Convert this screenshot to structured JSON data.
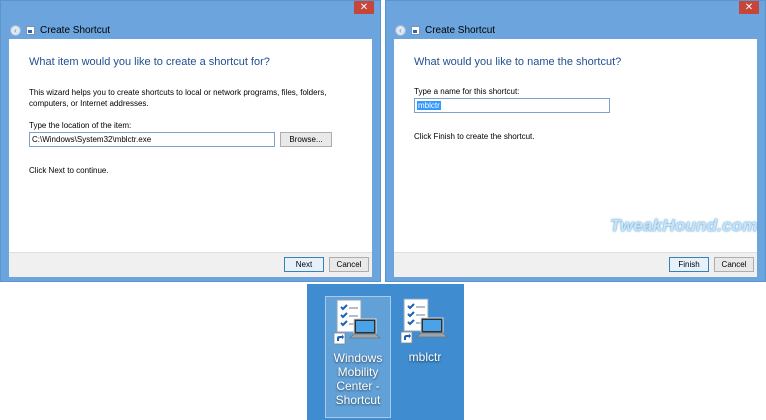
{
  "dialogs": {
    "left": {
      "title": "Create Shortcut",
      "close_glyph": "✕",
      "back_glyph": "‹",
      "heading": "What item would you like to create a shortcut for?",
      "description": "This wizard helps you to create shortcuts to local or network programs, files, folders, computers, or Internet addresses.",
      "field_label": "Type the location of the item:",
      "field_value": "C:\\Windows\\System32\\mblctr.exe",
      "browse_label": "Browse...",
      "note": "Click Next to continue.",
      "primary_label": "Next",
      "cancel_label": "Cancel"
    },
    "right": {
      "title": "Create Shortcut",
      "close_glyph": "✕",
      "back_glyph": "‹",
      "heading": "What would you like to name the shortcut?",
      "field_label": "Type a name for this shortcut:",
      "field_value": "mblctr",
      "note": "Click Finish to create the shortcut.",
      "primary_label": "Finish",
      "cancel_label": "Cancel"
    }
  },
  "watermark": "TweakHound.com",
  "desktop": {
    "background": "#3f8dd0",
    "items": [
      {
        "label": "Windows Mobility Center - Shortcut",
        "icon": "mobility-center-icon",
        "selected": true
      },
      {
        "label": "mblctr",
        "icon": "mobility-center-icon",
        "selected": false
      }
    ]
  },
  "colors": {
    "window_frame": "#6ca5dd",
    "heading_text": "#1f4f90",
    "close_button": "#c7463a",
    "selection": "#3399ff"
  }
}
